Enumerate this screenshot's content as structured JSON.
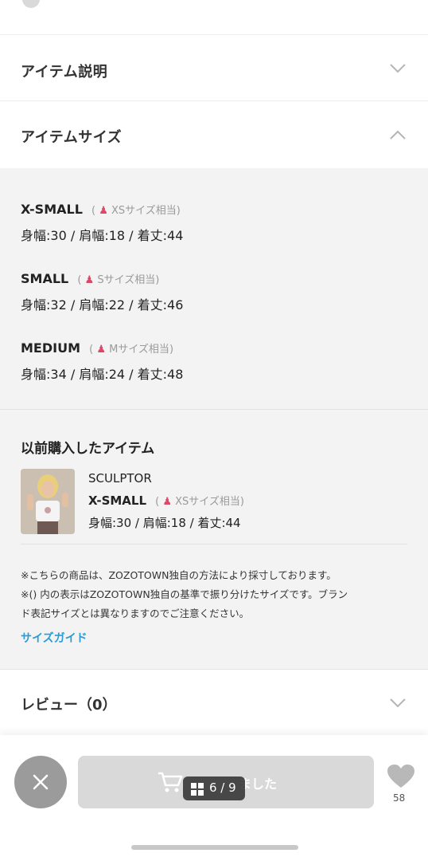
{
  "sections": {
    "description": {
      "title": "アイテム説明"
    },
    "size": {
      "title": "アイテムサイズ"
    },
    "review": {
      "title": "レビュー（0）"
    }
  },
  "sizes": [
    {
      "name": "X-SMALL",
      "equiv": "XSサイズ相当",
      "measurements": "身幅:30 / 肩幅:18 / 着丈:44"
    },
    {
      "name": "SMALL",
      "equiv": "Sサイズ相当",
      "measurements": "身幅:32 / 肩幅:22 / 着丈:46"
    },
    {
      "name": "MEDIUM",
      "equiv": "Mサイズ相当",
      "measurements": "身幅:34 / 肩幅:24 / 着丈:48"
    }
  ],
  "previous_purchase": {
    "title": "以前購入したアイテム",
    "brand": "SCULPTOR",
    "size_name": "X-SMALL",
    "size_equiv": "XSサイズ相当",
    "measurements": "身幅:30 / 肩幅:18 / 着丈:44"
  },
  "notes": {
    "line1": "※こちらの商品は、ZOZOTOWN独自の方法により採寸しております。",
    "line2a": "※() 内の表示はZOZOTOWN独自の基準で振り分けたサイズです。ブラン",
    "line2b": "ド表記サイズとは異なりますのでご注意ください。",
    "size_guide": "サイズガイド"
  },
  "footer": {
    "cart_label": "ました",
    "pager": "6 / 9",
    "favorite_count": "58"
  },
  "icons": {
    "collapse": "chevron-down-icon",
    "expand": "chevron-up-icon",
    "close": "close-icon",
    "cart": "cart-icon",
    "gallery": "grid-icon",
    "favorite": "heart-icon",
    "size_figure": "person-icon"
  },
  "colors": {
    "accent_link": "#2a9cd6",
    "figure_icon": "#e0466a",
    "panel_bg": "#f3f3f3"
  }
}
